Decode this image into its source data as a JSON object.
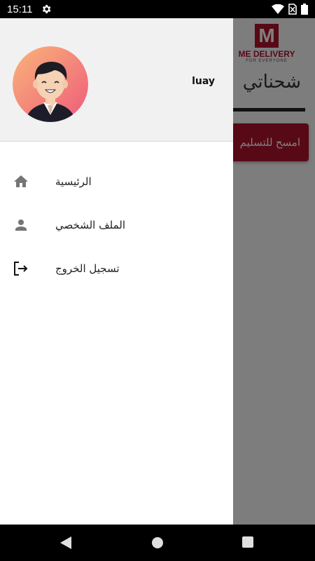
{
  "status_bar": {
    "time": "15:11",
    "icons": [
      "settings-icon",
      "wifi-icon",
      "no-sim-icon",
      "battery-icon"
    ]
  },
  "app": {
    "logo_letter": "M",
    "logo_text": "ME DELIVERY",
    "logo_subtext": "FOR EVERYONE",
    "page_title": "شحناتي",
    "scan_button_label": "امسح للتسليم",
    "accent_color": "#b0122d"
  },
  "drawer": {
    "user_name": "luay",
    "items": [
      {
        "label": "الرئيسية",
        "icon": "home-icon"
      },
      {
        "label": "الملف الشخصي",
        "icon": "person-icon"
      },
      {
        "label": "تسجيل الخروج",
        "icon": "logout-icon"
      }
    ]
  },
  "nav_bar": {
    "buttons": [
      "back-icon",
      "home-circle-icon",
      "recents-icon"
    ]
  }
}
